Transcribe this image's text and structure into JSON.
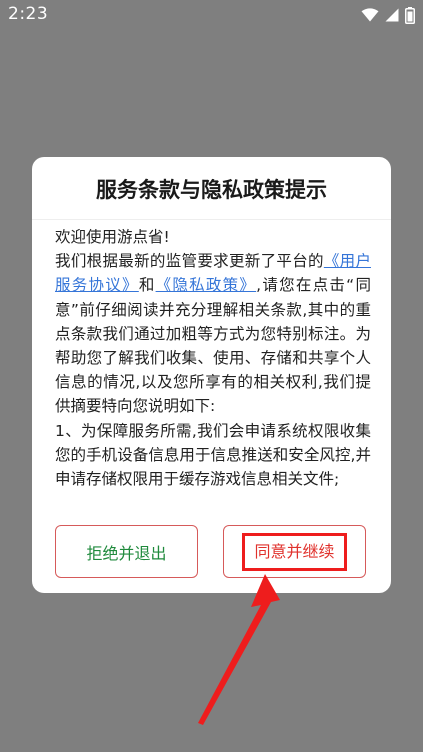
{
  "status_bar": {
    "time": "2:23",
    "icons": [
      "wifi-icon",
      "signal-icon",
      "battery-icon"
    ]
  },
  "dialog": {
    "title": "服务条款与隐私政策提示",
    "greeting": "欢迎使用游点省!",
    "text_intro": "我们根据最新的监管要求更新了平台的",
    "link_user_agreement": "《用户服务协议》",
    "text_and": "和",
    "link_privacy_policy": "《隐私政策》",
    "text_after_links": ",请您在点击“同意”前仔细阅读并充分理解相关条款,其中的重点条款我们通过加粗等方式为您特别标注。为帮助您了解我们收集、使用、存储和共享个人信息的情况,以及您所享有的相关权利,我们提供摘要特向您说明如下:",
    "item_1": "1、为保障服务所需,我们会申请系统权限收集您的手机设备信息用于信息推送和安全风控,并申请存储权限用于缓存游戏信息相关文件;",
    "buttons": {
      "reject_label": "拒绝并退出",
      "agree_label": "同意并继续"
    }
  },
  "colors": {
    "overlay": "#7f7f7f",
    "link": "#3575d8",
    "reject_text": "#1f8a3c",
    "agree_text": "#e0312c",
    "button_border": "#d65a5a",
    "annotation": "#ee1d1d"
  }
}
